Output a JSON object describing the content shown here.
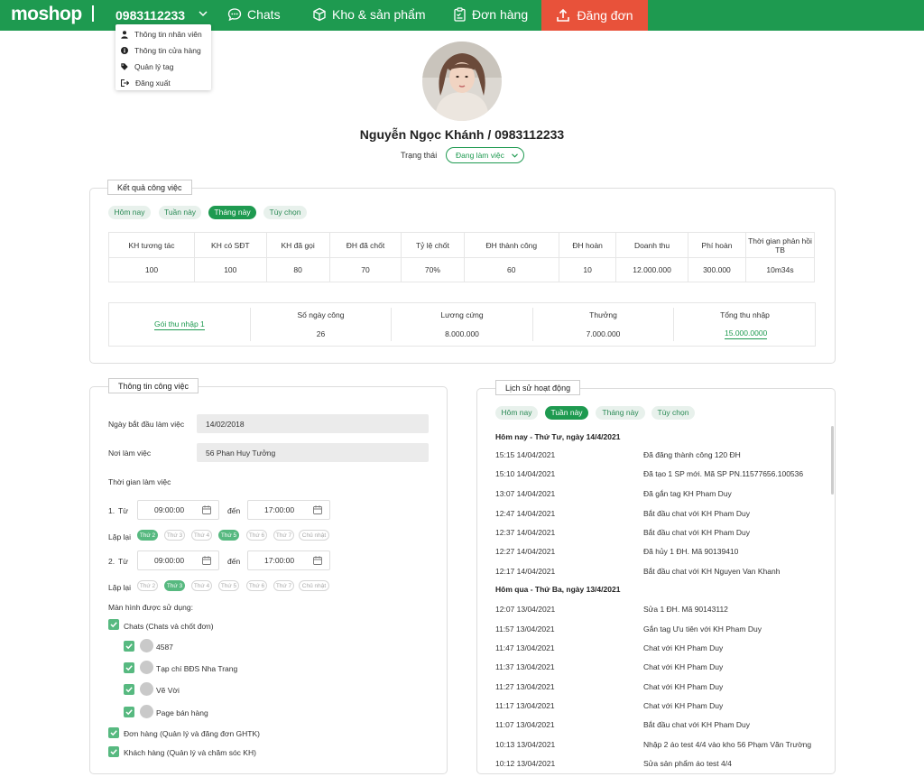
{
  "nav": {
    "brand": "moshop",
    "phone": "0983112233",
    "items": [
      {
        "label": "Chats",
        "icon": "chat-icon"
      },
      {
        "label": "Kho & sản phẩm",
        "icon": "box-icon"
      },
      {
        "label": "Đơn hàng",
        "icon": "clipboard-icon"
      }
    ],
    "post_label": "Đăng đơn",
    "colors": {
      "primary": "#1e9a50",
      "accent": "#e8523a"
    }
  },
  "account_menu": [
    {
      "label": "Thông tin nhân viên",
      "icon": "user-icon"
    },
    {
      "label": "Thông tin cửa hàng",
      "icon": "info-icon"
    },
    {
      "label": "Quản lý tag",
      "icon": "tag-icon"
    },
    {
      "label": "Đăng xuất",
      "icon": "logout-icon"
    }
  ],
  "profile": {
    "name": "Nguyễn Ngọc Khánh / 0983112233",
    "status_label": "Trạng thái",
    "status_value": "Đang làm việc"
  },
  "results": {
    "title": "Kết quả công việc",
    "filters": [
      "Hôm nay",
      "Tuần này",
      "Tháng này",
      "Tùy chọn"
    ],
    "active_filter": "Tháng này",
    "headers": [
      "KH tương tác",
      "KH có SĐT",
      "KH đã gọi",
      "ĐH đã chốt",
      "Tỷ lệ chốt",
      "ĐH thành công",
      "ĐH hoàn",
      "Doanh thu",
      "Phí hoàn",
      "Thời gian phản hồi TB"
    ],
    "values": [
      "100",
      "100",
      "80",
      "70",
      "70%",
      "60",
      "10",
      "12.000.000",
      "300.000",
      "10m34s"
    ],
    "income": {
      "package": "Gói thu nhập 1",
      "headers": [
        "Số ngày công",
        "Lương cứng",
        "Thưởng",
        "Tổng thu nhập"
      ],
      "values": [
        "26",
        "8.000.000",
        "7.000.000",
        "15.000.0000"
      ]
    }
  },
  "work_info": {
    "title": "Thông tin công việc",
    "start_label": "Ngày bắt đầu làm việc",
    "start_value": "14/02/2018",
    "place_label": "Nơi làm việc",
    "place_value": "56 Phan Huy Tưởng",
    "time_label": "Thời gian làm việc",
    "from_label": "Từ",
    "to_label": "đến",
    "repeat_label": "Lặp lại",
    "days": [
      "Thứ 2",
      "Thứ 3",
      "Thứ 4",
      "Thứ 5",
      "Thứ 6",
      "Thứ 7",
      "Chủ nhật"
    ],
    "shifts": [
      {
        "num": "1.",
        "from": "09:00:00",
        "to": "17:00:00",
        "days_on": [
          true,
          false,
          false,
          true,
          false,
          false,
          false
        ]
      },
      {
        "num": "2.",
        "from": "09:00:00",
        "to": "17:00:00",
        "days_on": [
          false,
          true,
          false,
          false,
          false,
          false,
          false
        ]
      }
    ],
    "screens_label": "Màn hình được sử dụng:",
    "chats_label": "Chats (Chats và chốt đơn)",
    "pages": [
      "4587",
      "Tạp chí BĐS Nha Trang",
      "Vẽ Vời",
      "Page bán hàng"
    ],
    "orders_label": "Đơn hàng (Quản lý và đăng đơn GHTK)",
    "customers_label": "Khách hàng (Quản lý và chăm sóc KH)"
  },
  "activity": {
    "title": "Lịch sử hoạt động",
    "filters": [
      "Hôm nay",
      "Tuần này",
      "Tháng này",
      "Tùy chọn"
    ],
    "active_filter": "Tuần này",
    "groups": [
      {
        "heading": "Hôm nay - Thứ Tư, ngày 14/4/2021",
        "rows": [
          {
            "time": "15:15  14/04/2021",
            "desc": "Đã đăng thành công 120 ĐH"
          },
          {
            "time": "15:10  14/04/2021",
            "desc": "Đã tạo 1 SP mới. Mã SP PN.11577656.100536"
          },
          {
            "time": "13:07  14/04/2021",
            "desc": "Đã gắn tag KH Pham Duy"
          },
          {
            "time": "12:47  14/04/2021",
            "desc": "Bắt đầu chat với KH Pham Duy"
          },
          {
            "time": "12:37  14/04/2021",
            "desc": "Bắt đầu chat với KH Pham Duy"
          },
          {
            "time": "12:27  14/04/2021",
            "desc": "Đã hủy 1 ĐH. Mã 90139410"
          },
          {
            "time": "12:17  14/04/2021",
            "desc": "Bắt đầu chat với KH Nguyen Van Khanh"
          }
        ]
      },
      {
        "heading": "Hôm qua - Thứ Ba, ngày 13/4/2021",
        "rows": [
          {
            "time": "12:07  13/04/2021",
            "desc": "Sửa 1 ĐH. Mã 90143112"
          },
          {
            "time": "11:57  13/04/2021",
            "desc": "Gắn tag Ưu tiên với KH Pham Duy"
          },
          {
            "time": "11:47  13/04/2021",
            "desc": "Chat với KH Pham Duy"
          },
          {
            "time": "11:37  13/04/2021",
            "desc": "Chat với KH Pham Duy"
          },
          {
            "time": "11:27  13/04/2021",
            "desc": "Chat với KH Pham Duy"
          },
          {
            "time": "11:17  13/04/2021",
            "desc": "Chat với KH Pham Duy"
          },
          {
            "time": "11:07  13/04/2021",
            "desc": "Bắt đầu chat với KH Pham Duy"
          },
          {
            "time": "10:13  13/04/2021",
            "desc": "Nhập 2 áo test 4/4 vào kho 56 Phạm Văn Trường"
          },
          {
            "time": "10:12  13/04/2021",
            "desc": "Sửa sản phẩm áo test 4/4"
          }
        ]
      }
    ]
  }
}
